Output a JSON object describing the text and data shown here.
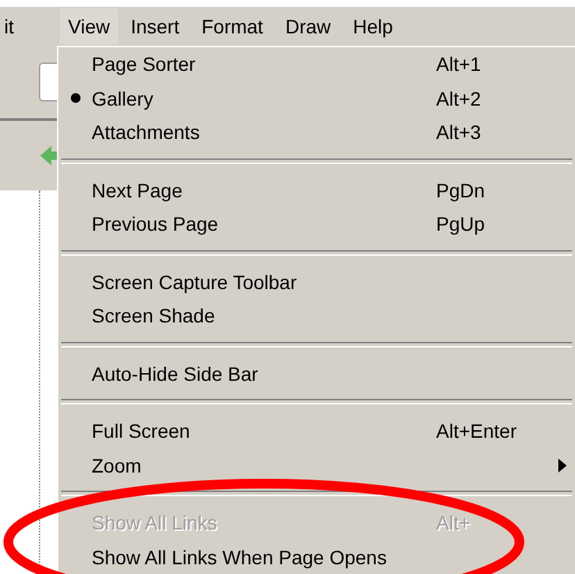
{
  "menubar": [
    {
      "label": "it",
      "selected": false
    },
    {
      "label": "View",
      "selected": true
    },
    {
      "label": "Insert",
      "selected": false
    },
    {
      "label": "Format",
      "selected": false
    },
    {
      "label": "Draw",
      "selected": false
    },
    {
      "label": "Help",
      "selected": false
    }
  ],
  "menu": [
    {
      "kind": "item",
      "label": "Page Sorter",
      "shortcut": "Alt+1",
      "checked": false
    },
    {
      "kind": "item",
      "label": "Gallery",
      "shortcut": "Alt+2",
      "checked": true
    },
    {
      "kind": "item",
      "label": "Attachments",
      "shortcut": "Alt+3",
      "checked": false
    },
    {
      "kind": "separator"
    },
    {
      "kind": "item",
      "label": "Next Page",
      "shortcut": "PgDn"
    },
    {
      "kind": "item",
      "label": "Previous Page",
      "shortcut": "PgUp"
    },
    {
      "kind": "separator"
    },
    {
      "kind": "item",
      "label": "Screen Capture Toolbar"
    },
    {
      "kind": "item",
      "label": "Screen Shade"
    },
    {
      "kind": "separator"
    },
    {
      "kind": "item",
      "label": "Auto-Hide Side Bar"
    },
    {
      "kind": "separator"
    },
    {
      "kind": "item",
      "label": "Full Screen",
      "shortcut": "Alt+Enter"
    },
    {
      "kind": "submenu",
      "label": "Zoom"
    },
    {
      "kind": "separator"
    },
    {
      "kind": "item",
      "label": "Show All Links",
      "shortcut": "Alt+",
      "disabled": true
    },
    {
      "kind": "item",
      "label": "Show All Links When Page Opens"
    }
  ]
}
